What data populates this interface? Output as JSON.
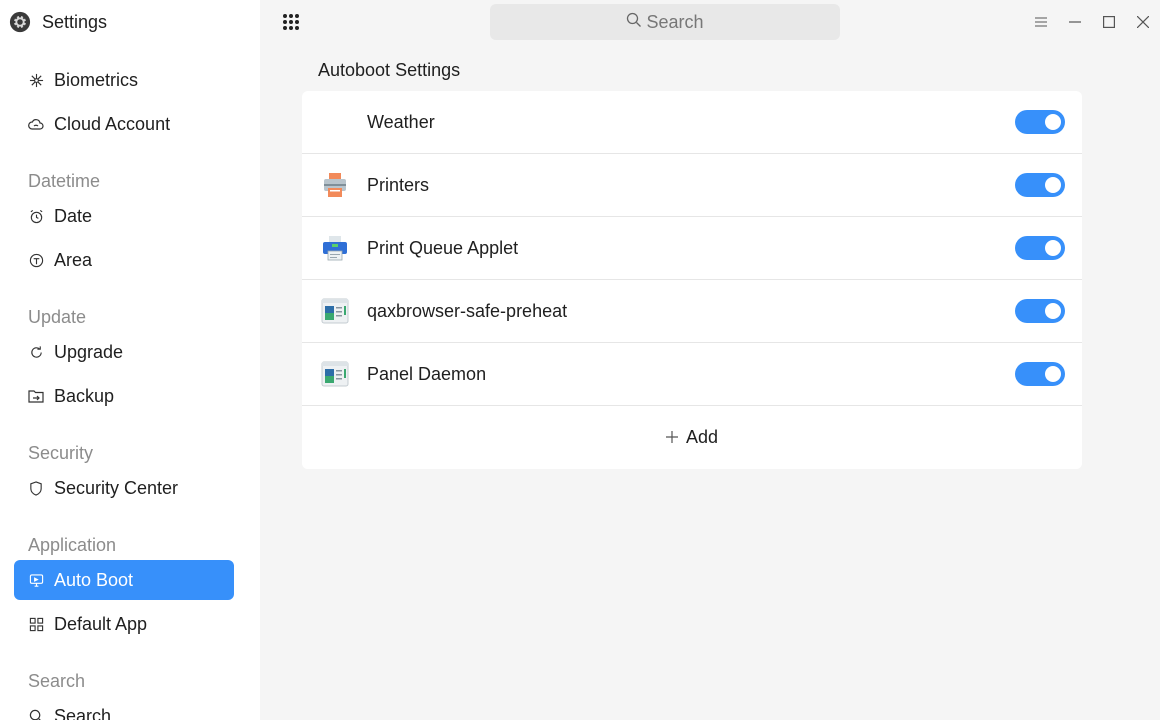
{
  "app": {
    "title": "Settings",
    "icon": "gear-icon"
  },
  "sidebar": {
    "top_items": [
      {
        "label": "Biometrics",
        "icon": "biometrics-icon"
      },
      {
        "label": "Cloud Account",
        "icon": "cloud-icon"
      }
    ],
    "groups": [
      {
        "label": "Datetime",
        "items": [
          {
            "label": "Date",
            "icon": "clock-icon"
          },
          {
            "label": "Area",
            "icon": "area-icon"
          }
        ]
      },
      {
        "label": "Update",
        "items": [
          {
            "label": "Upgrade",
            "icon": "refresh-icon"
          },
          {
            "label": "Backup",
            "icon": "backup-icon"
          }
        ]
      },
      {
        "label": "Security",
        "items": [
          {
            "label": "Security Center",
            "icon": "shield-icon"
          }
        ]
      },
      {
        "label": "Application",
        "items": [
          {
            "label": "Auto Boot",
            "icon": "autoboot-icon",
            "active": true
          },
          {
            "label": "Default App",
            "icon": "grid-icon"
          }
        ]
      },
      {
        "label": "Search",
        "items": [
          {
            "label": "Search",
            "icon": "search-icon"
          }
        ]
      }
    ]
  },
  "search": {
    "placeholder": "Search"
  },
  "main": {
    "title": "Autoboot Settings",
    "apps": [
      {
        "name": "Weather",
        "icon": "none",
        "enabled": true
      },
      {
        "name": "Printers",
        "icon": "printer-icon",
        "enabled": true
      },
      {
        "name": "Print Queue Applet",
        "icon": "print-queue-icon",
        "enabled": true
      },
      {
        "name": "qaxbrowser-safe-preheat",
        "icon": "app-window-icon",
        "enabled": true
      },
      {
        "name": "Panel Daemon",
        "icon": "app-window-icon",
        "enabled": true
      }
    ],
    "add_label": "Add"
  },
  "colors": {
    "accent": "#3790fa",
    "sidebar_bg": "#ffffff",
    "main_bg": "#f5f5f5"
  }
}
